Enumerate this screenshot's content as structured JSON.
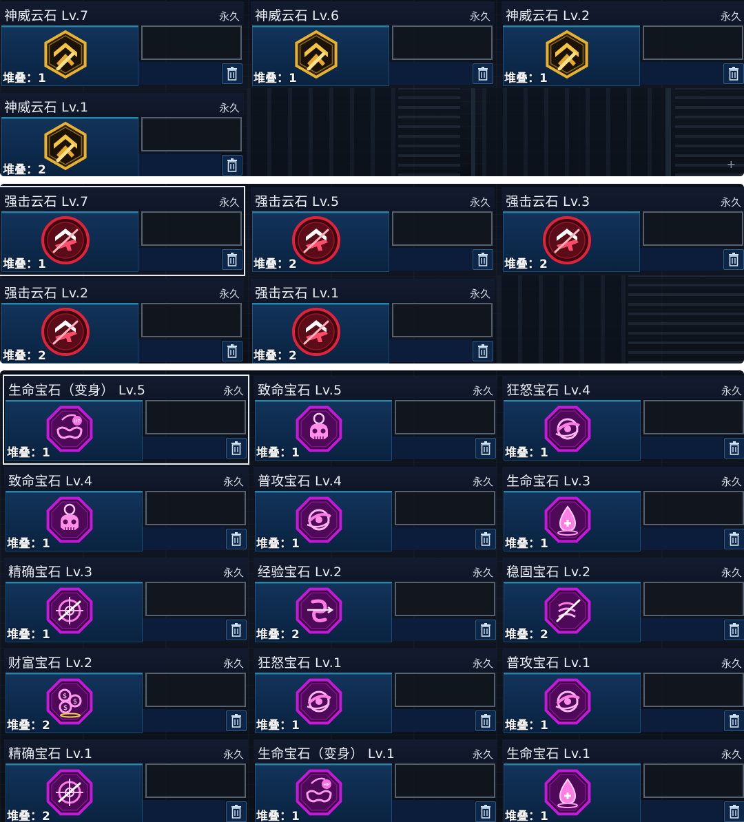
{
  "labels": {
    "permanent": "永久",
    "stack_prefix": "堆叠："
  },
  "colors": {
    "gold": "#e8b230",
    "red": "#e0223a",
    "purple": "#c419d8"
  },
  "sections": [
    {
      "items": [
        {
          "name": "神威云石 Lv.7",
          "stack": "1",
          "icon": "shenwei-gold-chevron-icon"
        },
        {
          "name": "神威云石 Lv.6",
          "stack": "1",
          "icon": "shenwei-gold-chevron-icon"
        },
        {
          "name": "神威云石 Lv.2",
          "stack": "1",
          "icon": "shenwei-gold-chevron-icon"
        },
        {
          "name": "神威云石 Lv.1",
          "stack": "2",
          "icon": "shenwei-gold-chevron-icon"
        }
      ]
    },
    {
      "items": [
        {
          "name": "强击云石 Lv.7",
          "stack": "1",
          "icon": "qiangji-red-gun-icon"
        },
        {
          "name": "强击云石 Lv.5",
          "stack": "2",
          "icon": "qiangji-red-gun-icon"
        },
        {
          "name": "强击云石 Lv.3",
          "stack": "2",
          "icon": "qiangji-red-gun-icon"
        },
        {
          "name": "强击云石 Lv.2",
          "stack": "2",
          "icon": "qiangji-red-gun-icon"
        },
        {
          "name": "强击云石 Lv.1",
          "stack": "2",
          "icon": "qiangji-red-gun-icon"
        }
      ]
    },
    {
      "items": [
        {
          "name": "生命宝石（变身） Lv.5",
          "stack": "1",
          "icon": "hp-mask-icon"
        },
        {
          "name": "致命宝石 Lv.5",
          "stack": "1",
          "icon": "skull-icon"
        },
        {
          "name": "狂怒宝石 Lv.4",
          "stack": "1",
          "icon": "rage-swirl-icon"
        },
        {
          "name": "致命宝石 Lv.4",
          "stack": "1",
          "icon": "skull-icon"
        },
        {
          "name": "普攻宝石 Lv.4",
          "stack": "1",
          "icon": "rage-swirl-icon"
        },
        {
          "name": "生命宝石 Lv.3",
          "stack": "1",
          "icon": "blood-drop-icon"
        },
        {
          "name": "精确宝石 Lv.3",
          "stack": "1",
          "icon": "crosshair-icon"
        },
        {
          "name": "经验宝石 Lv.2",
          "stack": "2",
          "icon": "exp-spiral-icon"
        },
        {
          "name": "稳固宝石 Lv.2",
          "stack": "2",
          "icon": "stable-waves-icon"
        },
        {
          "name": "财富宝石 Lv.2",
          "stack": "2",
          "icon": "coins-icon"
        },
        {
          "name": "狂怒宝石 Lv.1",
          "stack": "1",
          "icon": "rage-swirl-icon"
        },
        {
          "name": "普攻宝石 Lv.1",
          "stack": "1",
          "icon": "rage-swirl-icon"
        },
        {
          "name": "精确宝石 Lv.1",
          "stack": "2",
          "icon": "crosshair-icon"
        },
        {
          "name": "生命宝石（变身） Lv.1",
          "stack": "1",
          "icon": "hp-mask-icon"
        },
        {
          "name": "生命宝石 Lv.1",
          "stack": "1",
          "icon": "blood-drop-icon"
        }
      ]
    }
  ],
  "selected": [
    "强击云石 Lv.7",
    "生命宝石（变身） Lv.5"
  ]
}
